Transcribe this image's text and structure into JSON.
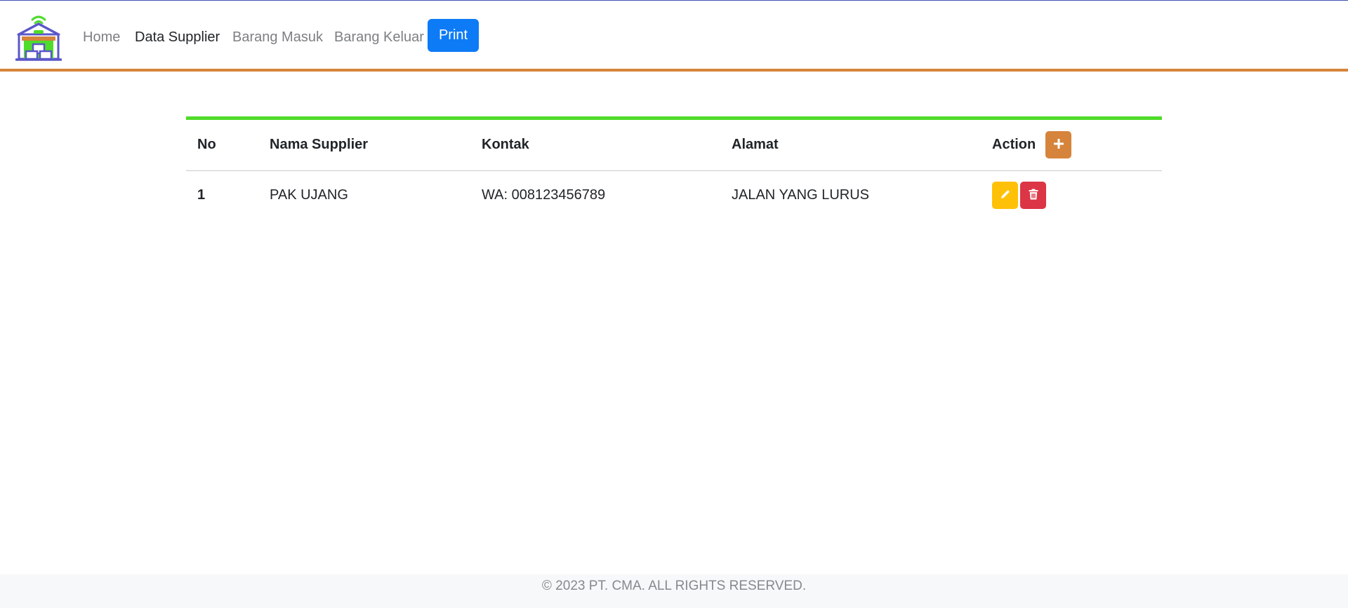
{
  "nav": {
    "links": [
      {
        "label": "Home",
        "active": false
      },
      {
        "label": "Data Supplier",
        "active": true
      },
      {
        "label": "Barang Masuk",
        "active": false
      },
      {
        "label": "Barang Keluar",
        "active": false
      }
    ],
    "print_label": "Print"
  },
  "table": {
    "headers": {
      "no": "No",
      "nama": "Nama Supplier",
      "kontak": "Kontak",
      "alamat": "Alamat",
      "action": "Action"
    },
    "rows": [
      {
        "no": "1",
        "nama": "PAK UJANG",
        "kontak": "WA: 008123456789",
        "alamat": "JALAN YANG LURUS"
      }
    ]
  },
  "footer": {
    "text": "© 2023 PT. CMA. ALL RIGHTS RESERVED."
  },
  "colors": {
    "accent_orange": "#d6843b",
    "accent_green": "#4fdc2a",
    "primary_blue": "#0d7bf6",
    "warning_yellow": "#ffc107",
    "danger_red": "#dc3545"
  },
  "icons": {
    "logo": "warehouse-logo-icon",
    "add": "plus-icon",
    "edit": "pencil-icon",
    "delete": "trash-icon"
  }
}
